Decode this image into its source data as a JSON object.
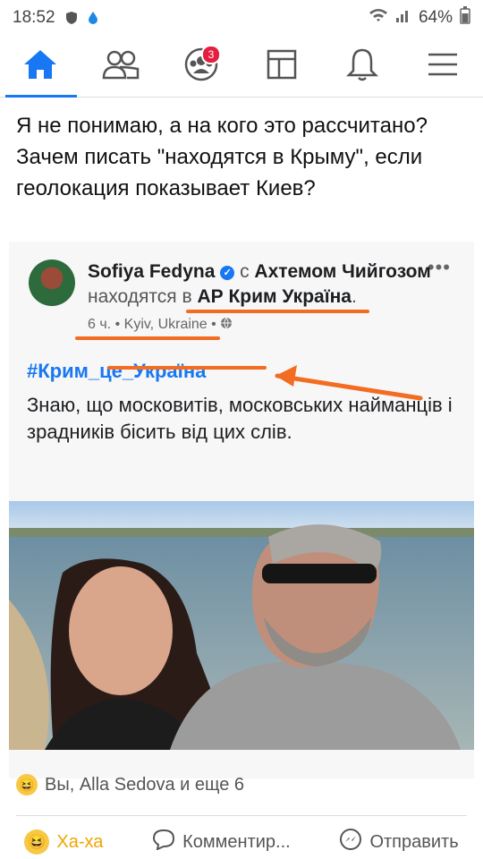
{
  "status": {
    "time": "18:52",
    "battery": "64%"
  },
  "nav": {
    "badge": "3"
  },
  "post": {
    "text": "Я не понимаю, а на кого это рассчитано? Зачем писать \"находятся в Крыму\", если геолокация показывает Киев?"
  },
  "shared": {
    "author": "Sofiya Fedyna",
    "with_word": "с",
    "with_name": "Ахтемом Чийгозом",
    "location_phrase": "находятся в",
    "place": "АР Крим Україна",
    "period": ".",
    "time": "6 ч.",
    "dot1": "•",
    "location": "Kyiv, Ukraine",
    "dot2": "•",
    "more": "•••",
    "hashtag": "#Крим_це_Україна",
    "body": "Знаю, що московитів, московських найманців і зрадників бісить від цих слів."
  },
  "reactions": {
    "text": "Вы, Alla Sedova и еще 6"
  },
  "actions": {
    "haha": "Ха-ха",
    "comment": "Комментир...",
    "share": "Отправить"
  },
  "colors": {
    "accent": "#1877f2",
    "annotation": "#f26c22"
  }
}
